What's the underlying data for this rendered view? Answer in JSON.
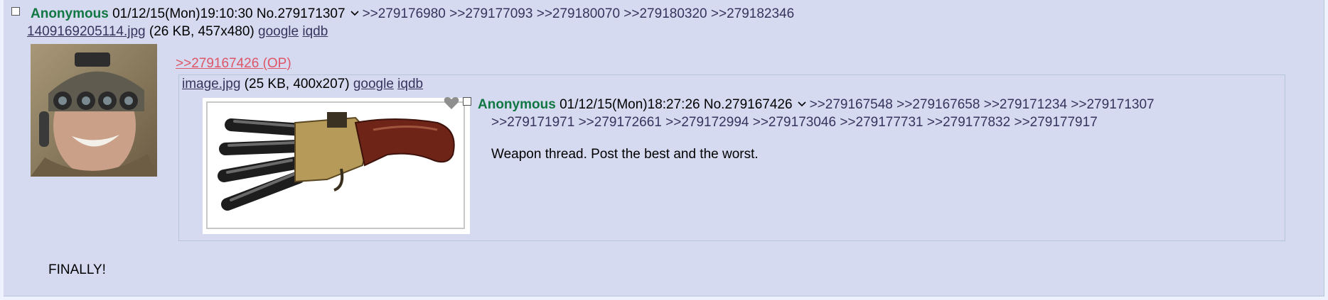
{
  "post": {
    "name": "Anonymous",
    "datetime": "01/12/15(Mon)19:10:30",
    "number": "No.279171307",
    "backlinks": [
      ">>279176980",
      ">>279177093",
      ">>279180070",
      ">>279180320",
      ">>279182346"
    ],
    "file": {
      "filename": "1409169205114.jpg",
      "info": "(26 KB, 457x480)",
      "google": "google",
      "iqdb": "iqdb"
    },
    "op_quote": ">>279167426 (OP)",
    "message": "FINALLY!"
  },
  "inline_post": {
    "file": {
      "filename": "image.jpg",
      "info": "(25 KB, 400x207)",
      "google": "google",
      "iqdb": "iqdb"
    },
    "name": "Anonymous",
    "datetime": "01/12/15(Mon)18:27:26",
    "number": "No.279167426",
    "backlinks_line1": [
      ">>279167548",
      ">>279167658",
      ">>279171234",
      ">>279171307"
    ],
    "backlinks_line2": [
      ">>279171971",
      ">>279172661",
      ">>279172994",
      ">>279173046",
      ">>279177731",
      ">>279177832",
      ">>279177917"
    ],
    "message": "Weapon thread. Post the best and the worst."
  },
  "colors": {
    "name": "#117743",
    "quote_op": "#dd5566",
    "link": "#34345c",
    "reply_bg": "#d6daf0",
    "page_bg": "#eef2ff"
  },
  "icons": [
    "checkbox",
    "chevron-down-icon",
    "heart-icon"
  ]
}
